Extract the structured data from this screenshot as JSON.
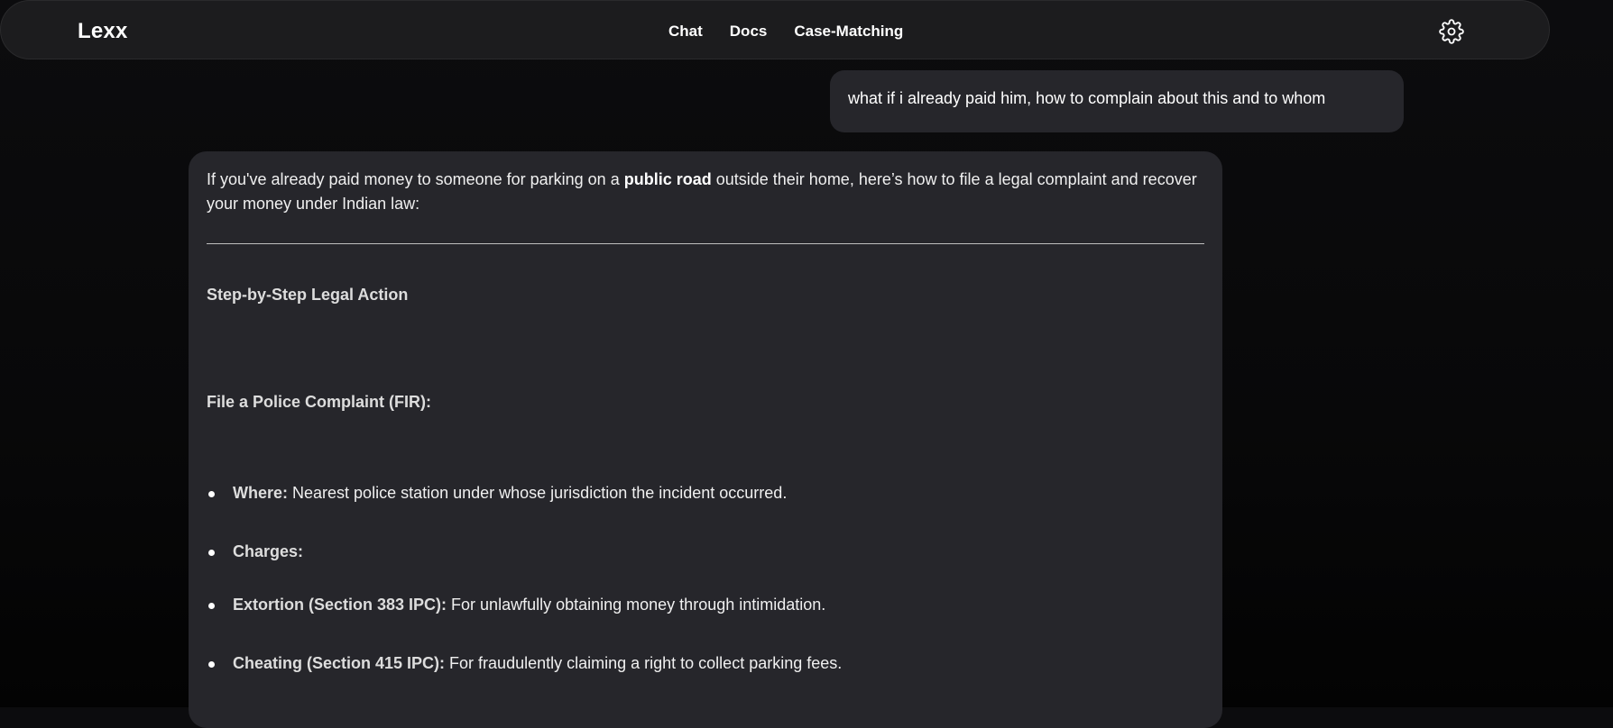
{
  "navbar": {
    "brand": "Lexx",
    "links": [
      "Chat",
      "Docs",
      "Case-Matching"
    ],
    "settings_icon": "gear-icon"
  },
  "chat": {
    "user_message": "what if i already paid him, how to complain about this and to whom",
    "assistant": {
      "intro_pre": "If you've already paid money to someone for parking on a ",
      "intro_bold": "public road",
      "intro_post": " outside their home, here’s how to file a legal complaint and recover your money under Indian law:",
      "heading_steps": "Step-by-Step Legal Action",
      "heading_fir": "File a Police Complaint (FIR):",
      "bullets": [
        {
          "label": "Where:",
          "text": " Nearest police station under whose jurisdiction the incident occurred."
        },
        {
          "label": "Charges:",
          "text": ""
        },
        {
          "label": "Extortion (Section 383 IPC):",
          "text": " For unlawfully obtaining money through intimidation."
        },
        {
          "label": "Cheating (Section 415 IPC):",
          "text": " For fraudulently claiming a right to collect parking fees."
        }
      ]
    }
  }
}
